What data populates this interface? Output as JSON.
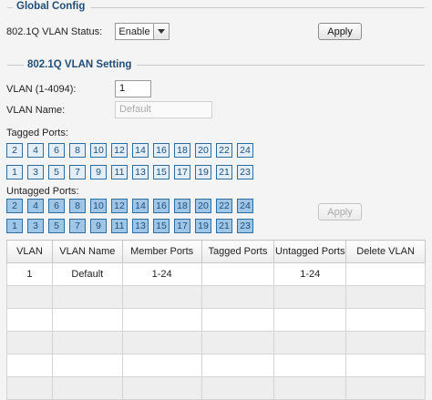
{
  "global_config": {
    "title": "Global Config",
    "status_label": "802.1Q VLAN Status:",
    "status_value": "Enable",
    "apply_label": "Apply"
  },
  "vlan_setting": {
    "title": "802.1Q VLAN Setting",
    "vlan_id_label": "VLAN (1-4094):",
    "vlan_id_value": "1",
    "vlan_name_label": "VLAN Name:",
    "vlan_name_placeholder": "Default",
    "tagged_label": "Tagged Ports:",
    "untagged_label": "Untagged Ports:",
    "apply_label": "Apply",
    "even_ports": [
      "2",
      "4",
      "6",
      "8",
      "10",
      "12",
      "14",
      "16",
      "18",
      "20",
      "22",
      "24"
    ],
    "odd_ports": [
      "1",
      "3",
      "5",
      "7",
      "9",
      "11",
      "13",
      "15",
      "17",
      "19",
      "21",
      "23"
    ]
  },
  "table": {
    "headers": [
      "VLAN",
      "VLAN Name",
      "Member Ports",
      "Tagged Ports",
      "Untagged Ports",
      "Delete VLAN"
    ],
    "rows": [
      [
        "1",
        "Default",
        "1-24",
        "",
        "1-24",
        ""
      ],
      [
        "",
        "",
        "",
        "",
        "",
        ""
      ],
      [
        "",
        "",
        "",
        "",
        "",
        ""
      ],
      [
        "",
        "",
        "",
        "",
        "",
        ""
      ],
      [
        "",
        "",
        "",
        "",
        "",
        ""
      ],
      [
        "",
        "",
        "",
        "",
        "",
        ""
      ]
    ]
  }
}
